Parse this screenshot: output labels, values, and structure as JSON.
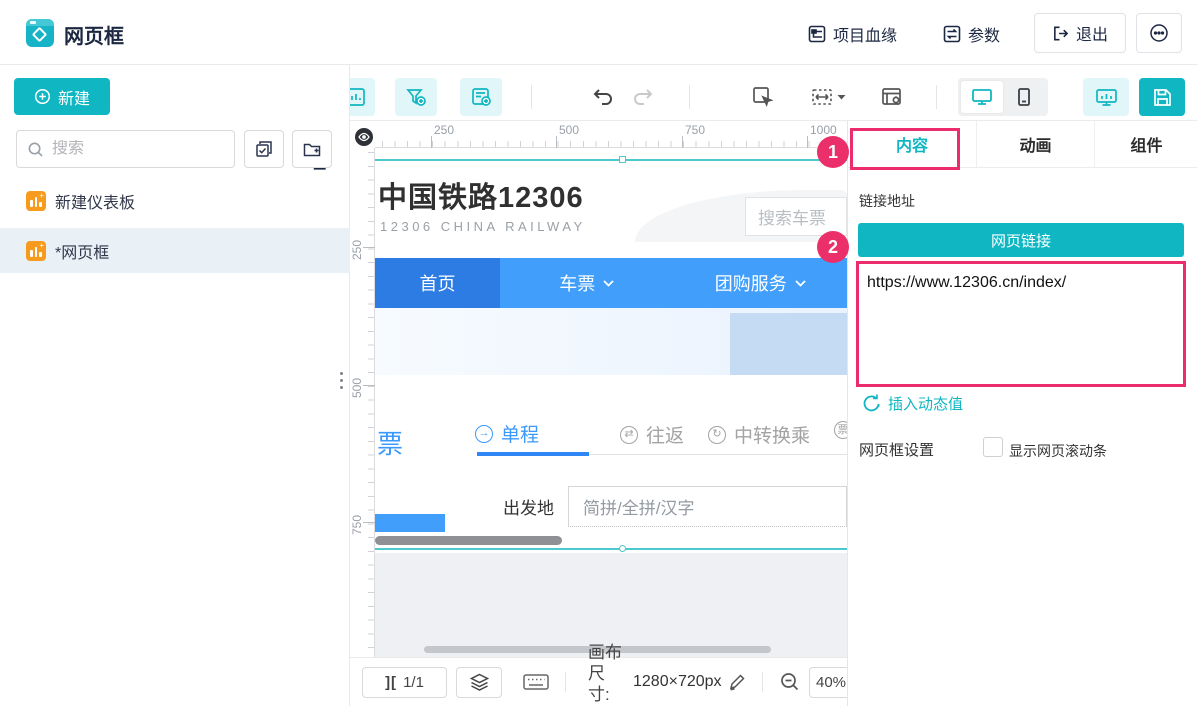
{
  "app": {
    "title": "网页框"
  },
  "header": {
    "lineage": "项目血缘",
    "params": "参数",
    "exit": "退出"
  },
  "sidebar": {
    "new_button": "新建",
    "search_placeholder": "搜索",
    "items": [
      {
        "label": "新建仪表板"
      },
      {
        "label": "*网页框"
      }
    ]
  },
  "ruler": {
    "h_labels": [
      "250",
      "500",
      "750",
      "1000"
    ],
    "v_labels": [
      "250",
      "500",
      "750"
    ]
  },
  "page": {
    "title": "中国铁路12306",
    "subtitle": "12306 CHINA RAILWAY",
    "search_placeholder": "搜索车票",
    "nav": [
      {
        "label": "首页"
      },
      {
        "label": "车票"
      },
      {
        "label": "团购服务"
      }
    ],
    "ticket_fragment": "票",
    "tabs": [
      {
        "label": "单程"
      },
      {
        "label": "往返"
      },
      {
        "label": "中转换乘"
      }
    ],
    "partial_tab_char": "票",
    "depart_label": "出发地",
    "depart_placeholder": "简拼/全拼/汉字"
  },
  "bottombar": {
    "pages": "1/1",
    "pages_icon": "][",
    "size_label": "画布尺寸:",
    "size_value": "1280×720px",
    "zoom": "40%"
  },
  "panel": {
    "tabs": [
      {
        "label": "内容"
      },
      {
        "label": "动画"
      },
      {
        "label": "组件"
      }
    ],
    "link_label": "链接地址",
    "link_button": "网页链接",
    "url": "https://www.12306.cn/index/",
    "insert_dynamic": "插入动态值",
    "settings_label": "网页框设置",
    "checkbox_label": "显示网页滚动条"
  },
  "annotations": {
    "one": "1",
    "two": "2"
  },
  "colors": {
    "accent": "#10b7c2",
    "pink": "#ec2d6d",
    "nav_blue": "#419ffb",
    "nav_blue_dark": "#2c7ce4",
    "orange": "#f79b1e",
    "selection": "#4cc9cf"
  }
}
